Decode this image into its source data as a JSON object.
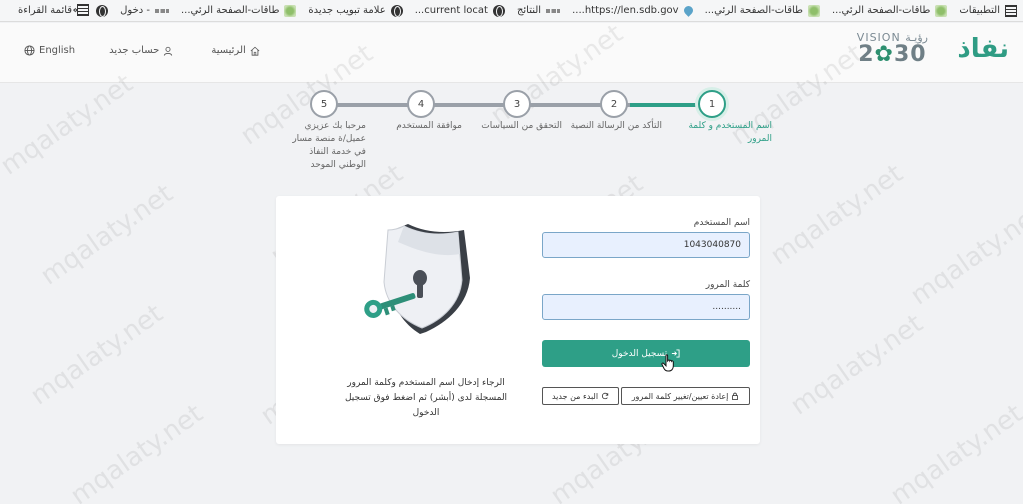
{
  "bookmarks": {
    "items": [
      {
        "label": "التطبيقات",
        "icon": "apps-grid-icon"
      },
      {
        "label": "طاقات-الصفحة الرئي...",
        "icon": "site-favicon"
      },
      {
        "label": "طاقات-الصفحة الرئي...",
        "icon": "site-favicon"
      },
      {
        "label": "https://len.sdb.gov....",
        "icon": "drop-favicon"
      },
      {
        "label": "النتائج",
        "icon": "dash-favicon"
      },
      {
        "label": "current locat...",
        "icon": "globe-icon"
      },
      {
        "label": "علامة تبويب جديدة",
        "icon": "globe-icon"
      },
      {
        "label": "طاقات-الصفحة الرئي...",
        "icon": "site-favicon"
      },
      {
        "label": "- دخول",
        "icon": "dash-favicon"
      },
      {
        "label": "",
        "icon": "globe-icon"
      }
    ],
    "more": "»",
    "reading_list": "قائمة القراءة"
  },
  "header": {
    "logo_text": "نفاذ",
    "vision_top": "VISION رؤيـة",
    "vision_year_a": "2",
    "vision_year_b": "30",
    "nav": {
      "home": "الرئيسية",
      "new_account": "حساب جديد",
      "language": "English"
    }
  },
  "stepper": {
    "steps": [
      {
        "number": "1",
        "label": "اسم المستخدم و كلمة المرور",
        "active": true
      },
      {
        "number": "2",
        "label": "التأكد من الرسالة النصية",
        "active": false
      },
      {
        "number": "3",
        "label": "التحقق من السياسات",
        "active": false
      },
      {
        "number": "4",
        "label": "موافقة المستخدم",
        "active": false
      },
      {
        "number": "5",
        "label": "مرحبا بك عزيزي عميل/ة منصة مسار في خدمة النفاذ الوطني الموحد",
        "active": false
      }
    ]
  },
  "form": {
    "username_label": "اسم المستخدم",
    "username_value": "1043040870",
    "password_label": "كلمة المرور",
    "password_value": "..........",
    "login_button": "تسجيل الدخول",
    "reset_button": "إعادة تعيين/تغيير كلمة المرور",
    "restart_button": "البدء من جديد",
    "hint": "الرجاء إدخال اسم المستخدم وكلمة المرور المسجلة لدى (أبشر) ثم اضغط فوق تسجيل الدخول"
  },
  "watermark": "mqalaty.net",
  "colors": {
    "accent": "#2e9f87",
    "input_bg": "#e8f0fe",
    "step_inactive": "#9aa0a8"
  }
}
